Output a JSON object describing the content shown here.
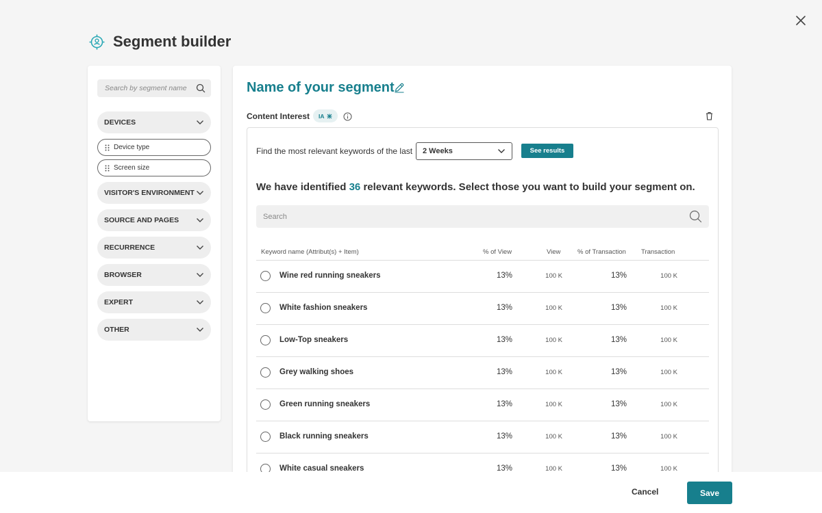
{
  "header": {
    "title": "Segment builder"
  },
  "sidebar": {
    "search_placeholder": "Search by segment name",
    "categories": [
      {
        "label": "DEVICES",
        "expanded": true,
        "subitems": [
          {
            "label": "Device type"
          },
          {
            "label": "Screen size"
          }
        ]
      },
      {
        "label": "VISITOR'S ENVIRONMENT"
      },
      {
        "label": "SOURCE AND PAGES"
      },
      {
        "label": "RECURRENCE"
      },
      {
        "label": "BROWSER"
      },
      {
        "label": "EXPERT"
      },
      {
        "label": "OTHER"
      }
    ]
  },
  "main": {
    "segment_name": "Name of your segment",
    "content_interest_label": "Content Interest",
    "ia_badge": "IA",
    "find_label": "Find the most relevant keywords of the last",
    "period_selected": "2 Weeks",
    "see_results_label": "See results",
    "identified_prefix": "We have identified",
    "identified_count": "36",
    "identified_suffix": "relevant keywords. Select those you want to build your segment on.",
    "search_placeholder": "Search",
    "columns": {
      "keyword": "Keyword name (Attribut(s) + Item)",
      "pct_view": "% of View",
      "view": "View",
      "pct_transaction": "% of Transaction",
      "transaction": "Transaction"
    },
    "rows": [
      {
        "name": "Wine red running sneakers",
        "pct_view": "13%",
        "view": "100 K",
        "pct_transaction": "13%",
        "transaction": "100 K"
      },
      {
        "name": "White fashion sneakers",
        "pct_view": "13%",
        "view": "100 K",
        "pct_transaction": "13%",
        "transaction": "100 K"
      },
      {
        "name": "Low-Top sneakers",
        "pct_view": "13%",
        "view": "100 K",
        "pct_transaction": "13%",
        "transaction": "100 K"
      },
      {
        "name": "Grey walking shoes",
        "pct_view": "13%",
        "view": "100 K",
        "pct_transaction": "13%",
        "transaction": "100 K"
      },
      {
        "name": "Green running sneakers",
        "pct_view": "13%",
        "view": "100 K",
        "pct_transaction": "13%",
        "transaction": "100 K"
      },
      {
        "name": "Black running sneakers",
        "pct_view": "13%",
        "view": "100 K",
        "pct_transaction": "13%",
        "transaction": "100 K"
      },
      {
        "name": "White casual sneakers",
        "pct_view": "13%",
        "view": "100 K",
        "pct_transaction": "13%",
        "transaction": "100 K"
      }
    ]
  },
  "footer": {
    "cancel_label": "Cancel",
    "save_label": "Save"
  },
  "colors": {
    "accent": "#177f8d",
    "background": "#f5f5f5",
    "pill": "#eeeeee"
  }
}
